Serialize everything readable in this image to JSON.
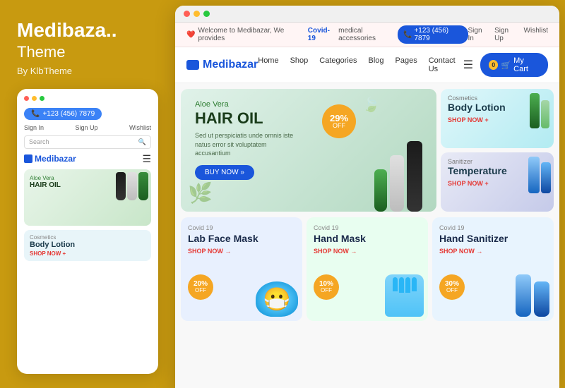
{
  "left": {
    "title": "Medibaza..",
    "subtitle": "Theme",
    "by": "By KlbTheme"
  },
  "mobile": {
    "phone": "+123 (456) 7879",
    "signin": "Sign In",
    "signup": "Sign Up",
    "wishlist": "Wishlist",
    "search_placeholder": "Search",
    "logo": "Medibazar",
    "hero_line1": "Aloe Vera",
    "hero_line2": "HAIR OIL",
    "lotion_cat": "Cosmetics",
    "lotion_title": "Body Lotion",
    "lotion_shop": "SHOP NOW +"
  },
  "browser": {
    "notif_welcome": "Welcome to Medibazar, We provides",
    "notif_covid": "Covid-19",
    "notif_covid_suffix": "medical accessories",
    "notif_phone": "+123 (456) 7879",
    "notif_signin": "Sign In",
    "notif_signup": "Sign Up",
    "notif_wishlist": "Wishlist",
    "logo": "Medibazar",
    "nav_home": "Home",
    "nav_shop": "Shop",
    "nav_categories": "Categories",
    "nav_blog": "Blog",
    "nav_pages": "Pages",
    "nav_contact": "Contact Us",
    "cart_count": "0",
    "cart_label": "My Cart"
  },
  "hero": {
    "subtitle": "Aloe Vera",
    "title": "HAIR OIL",
    "desc": "Sed ut perspiciatis unde omnis iste natus error sit voluptatem accusantium",
    "discount_pct": "29%",
    "discount_label": "OFF",
    "buy_label": "BUY NOW »"
  },
  "side_cards": [
    {
      "cat": "Cosmetics",
      "title": "Body Lotion",
      "shop": "SHOP NOW +"
    },
    {
      "cat": "Sanitizer",
      "title": "Temperature",
      "shop": "SHOP NOW +"
    }
  ],
  "products": [
    {
      "covid": "Covid 19",
      "title": "Lab Face Mask",
      "shop": "SHOP NOW →",
      "discount": "20%",
      "discount_label": "OFF"
    },
    {
      "covid": "Covid 19",
      "title": "Hand Mask",
      "shop": "SHOP NOW →",
      "discount": "10%",
      "discount_label": "OFF"
    },
    {
      "covid": "Covid 19",
      "title": "Hand Sanitizer",
      "shop": "SHOP NOW →",
      "discount": "30%",
      "discount_label": "OFF"
    }
  ]
}
